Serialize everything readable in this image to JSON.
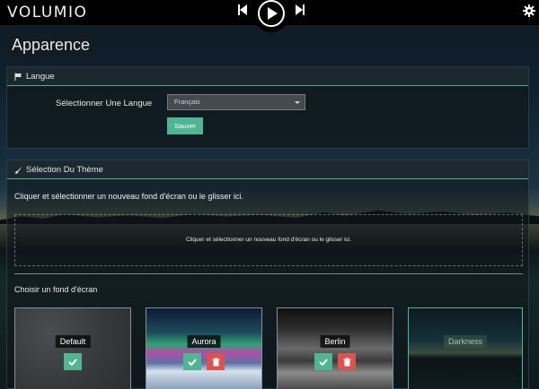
{
  "app": {
    "logo": "VOLUMIO"
  },
  "page": {
    "title": "Apparence"
  },
  "language_section": {
    "title": "Langue",
    "label": "Sélectionner Une Langue",
    "selected_language": "Français",
    "save_label": "Sauver"
  },
  "theme_section": {
    "title": "Sélection Du Thème",
    "instructions": "Cliquer et sélectionner un nouveau fond d'écran ou le glisser ici.",
    "dropzone_text": "Cliquer et sélectionner un nouveau fond d'écran ou le glisser ici.",
    "choose_label": "Choisir un fond d'écran",
    "backgrounds": [
      {
        "name": "Default",
        "actions": [
          "apply"
        ]
      },
      {
        "name": "Aurora",
        "actions": [
          "apply",
          "delete"
        ]
      },
      {
        "name": "Berlin",
        "actions": [
          "apply",
          "delete"
        ]
      },
      {
        "name": "Darkness",
        "selected": true,
        "actions": []
      }
    ]
  },
  "colors": {
    "accent": "#4fb592",
    "danger": "#d9534f",
    "header": "#000000"
  },
  "icons": {
    "previous": "skip-previous-icon",
    "play": "play-icon",
    "next": "skip-next-icon",
    "settings": "gear-icon",
    "language": "flag-icon",
    "theme": "paintbrush-icon",
    "apply": "checkmark-icon",
    "delete": "trash-icon"
  }
}
